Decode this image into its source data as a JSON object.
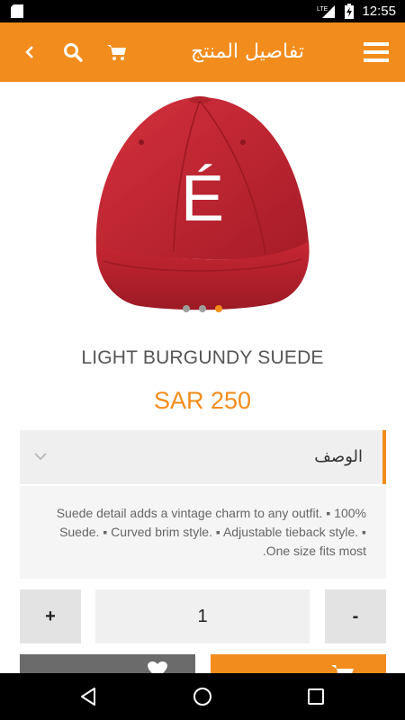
{
  "status_bar": {
    "time": "12:55",
    "network": "LTE"
  },
  "app_bar": {
    "title": "تفاصيل المنتج",
    "icons": [
      "back-icon",
      "search-icon",
      "cart-icon",
      "menu-icon"
    ]
  },
  "product": {
    "image_letter": "É",
    "name": "LIGHT BURGUNDY SUEDE",
    "price": "SAR 250",
    "gallery_dots": 3,
    "active_dot": 3
  },
  "description": {
    "label": "الوصف",
    "text": "Suede detail adds a vintage charm to any outfit. ▪ 100% Suede. ▪ Curved brim style. ▪ Adjustable tieback style. ▪ One size fits most."
  },
  "quantity": {
    "plus": "+",
    "value": "1",
    "minus": "-"
  },
  "colors": {
    "accent": "#f28c1c",
    "wishlist": "#6b6b6b"
  }
}
